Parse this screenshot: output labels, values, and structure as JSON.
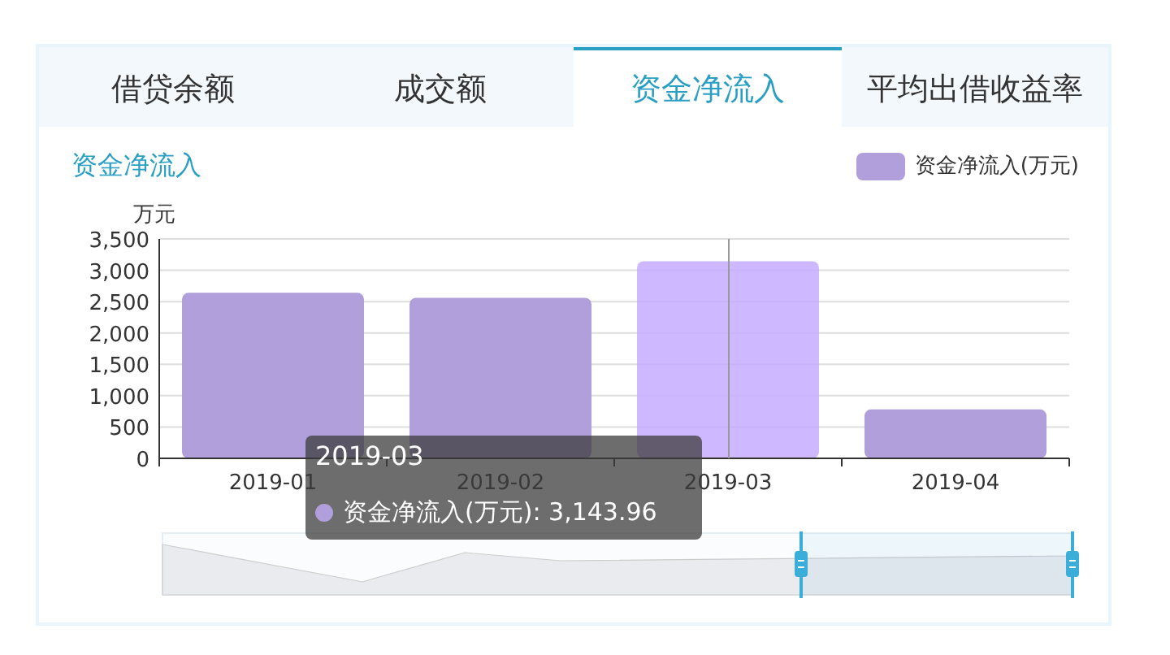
{
  "tabs": [
    {
      "label": "借贷余额",
      "selected": false
    },
    {
      "label": "成交额",
      "selected": false
    },
    {
      "label": "资金净流入",
      "selected": true
    },
    {
      "label": "平均出借收益率",
      "selected": false
    }
  ],
  "chart": {
    "title": "资金净流入",
    "hovered": [
      false,
      false,
      true,
      false
    ],
    "chart_data": {
      "type": "bar",
      "ylabel": "万元",
      "categories": [
        "2019-01",
        "2019-02",
        "2019-03",
        "2019-04"
      ],
      "series": [
        {
          "name": "资金净流入(万元)",
          "color": "#b19fdc",
          "values": [
            2640,
            2560,
            3143.96,
            780
          ]
        }
      ],
      "ylim": [
        0,
        3500
      ],
      "grid": true,
      "ref_lines": [
        {
          "axis": "x",
          "value": "2019-03",
          "color": "#999999"
        }
      ],
      "yticks": [
        0,
        {
          "value": 500,
          "label": "500"
        },
        {
          "value": 1000,
          "label": "1,000"
        },
        {
          "value": 1500,
          "label": "1,500"
        },
        {
          "value": 2000,
          "label": "2,000"
        },
        {
          "value": 2500,
          "label": "2,500"
        },
        {
          "value": 3000,
          "label": "3,000"
        },
        {
          "value": 3500,
          "label": "3,500"
        }
      ]
    },
    "tooltip": {
      "title": "2019-03",
      "label": "资金净流入(万元): 3,143.96"
    }
  }
}
